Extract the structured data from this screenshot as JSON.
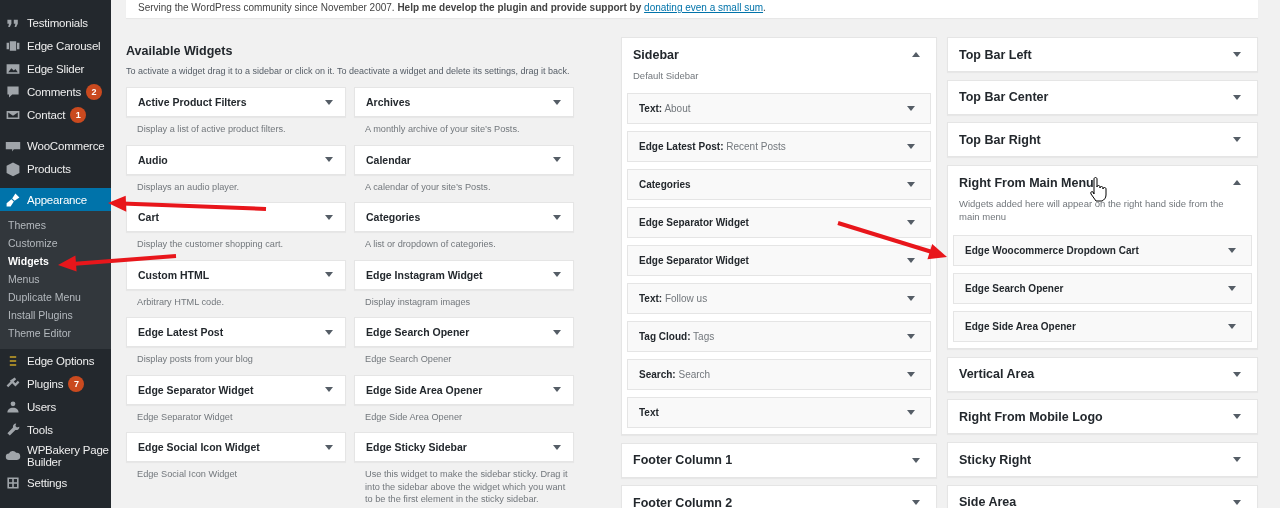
{
  "admin_menu": {
    "groups": [
      {
        "items": [
          {
            "label": "Testimonials",
            "selected": false
          },
          {
            "label": "Edge Carousel",
            "selected": false
          },
          {
            "label": "Edge Slider",
            "selected": false
          },
          {
            "label": "Comments",
            "selected": false,
            "badge": "2"
          },
          {
            "label": "Contact",
            "selected": false,
            "badge": "1"
          }
        ]
      },
      {
        "items": [
          {
            "label": "WooCommerce",
            "selected": false
          },
          {
            "label": "Products",
            "selected": false
          }
        ]
      },
      {
        "items": [
          {
            "label": "Appearance",
            "selected": true,
            "children": [
              {
                "label": "Themes",
                "selected": false
              },
              {
                "label": "Customize",
                "selected": false
              },
              {
                "label": "Widgets",
                "selected": true
              },
              {
                "label": "Menus",
                "selected": false
              },
              {
                "label": "Duplicate Menu",
                "selected": false
              },
              {
                "label": "Install Plugins",
                "selected": false
              },
              {
                "label": "Theme Editor",
                "selected": false
              }
            ]
          },
          {
            "label": "Edge Options",
            "selected": false
          },
          {
            "label": "Plugins",
            "selected": false,
            "badge": "7"
          },
          {
            "label": "Users",
            "selected": false
          },
          {
            "label": "Tools",
            "selected": false
          },
          {
            "label": "WPBakery Page Builder",
            "selected": false
          },
          {
            "label": "Settings",
            "selected": false
          }
        ]
      }
    ]
  },
  "notice": {
    "text": "Serving the WordPress community since November 2007. **Help me develop the plugin and provide support by**",
    "link": "donating even a small sum",
    "text_after": "."
  },
  "available_widgets": {
    "title": "Available Widgets",
    "description": "To activate a widget drag it to a sidebar or click on it. To deactivate a widget and delete its settings, drag it back.",
    "widgets": [
      {
        "name": "Active Product Filters",
        "description": "Display a list of active product filters."
      },
      {
        "name": "Archives",
        "description": "A monthly archive of your site’s Posts."
      },
      {
        "name": "Audio",
        "description": "Displays an audio player."
      },
      {
        "name": "Calendar",
        "description": "A calendar of your site’s Posts."
      },
      {
        "name": "Cart",
        "description": "Display the customer shopping cart."
      },
      {
        "name": "Categories",
        "description": "A list or dropdown of categories."
      },
      {
        "name": "Custom HTML",
        "description": "Arbitrary HTML code."
      },
      {
        "name": "Edge Instagram Widget",
        "description": "Display instagram images"
      },
      {
        "name": "Edge Latest Post",
        "description": "Display posts from your blog"
      },
      {
        "name": "Edge Search Opener",
        "description": "Edge Search Opener"
      },
      {
        "name": "Edge Separator Widget",
        "description": "Edge Separator Widget"
      },
      {
        "name": "Edge Side Area Opener",
        "description": "Edge Side Area Opener"
      },
      {
        "name": "Edge Social Icon Widget",
        "description": "Edge Social Icon Widget"
      },
      {
        "name": "Edge Sticky Sidebar",
        "description": "Use this widget to make the sidebar sticky. Drag it into the sidebar above the widget which you want to be the first element in the sticky sidebar."
      }
    ]
  },
  "widget_area_columns": [
    {
      "areas": [
        {
          "title": "Sidebar",
          "expanded": true,
          "description": "Default Sidebar",
          "widgets": [
            {
              "name": "Text:",
              "title": "About"
            },
            {
              "name": "Edge Latest Post:",
              "title": "Recent Posts"
            },
            {
              "name": "Categories"
            },
            {
              "name": "Edge Separator Widget"
            },
            {
              "name": "Edge Separator Widget"
            },
            {
              "name": "Text:",
              "title": "Follow us"
            },
            {
              "name": "Tag Cloud:",
              "title": "Tags"
            },
            {
              "name": "Search:",
              "title": "Search"
            },
            {
              "name": "Text"
            }
          ]
        },
        {
          "title": "Footer Column 1",
          "expanded": false
        },
        {
          "title": "Footer Column 2",
          "expanded": false
        }
      ]
    },
    {
      "areas": [
        {
          "title": "Top Bar Left",
          "expanded": false
        },
        {
          "title": "Top Bar Center",
          "expanded": false
        },
        {
          "title": "Top Bar Right",
          "expanded": false
        },
        {
          "title": "Right From Main Menu",
          "expanded": true,
          "description": "Widgets added here will appear on the right hand side from the main menu",
          "widgets": [
            {
              "name": "Edge Woocommerce Dropdown Cart"
            },
            {
              "name": "Edge Search Opener"
            },
            {
              "name": "Edge Side Area Opener"
            }
          ]
        },
        {
          "title": "Vertical Area",
          "expanded": false
        },
        {
          "title": "Right From Mobile Logo",
          "expanded": false
        },
        {
          "title": "Sticky Right",
          "expanded": false
        },
        {
          "title": "Side Area",
          "expanded": false
        }
      ]
    }
  ]
}
